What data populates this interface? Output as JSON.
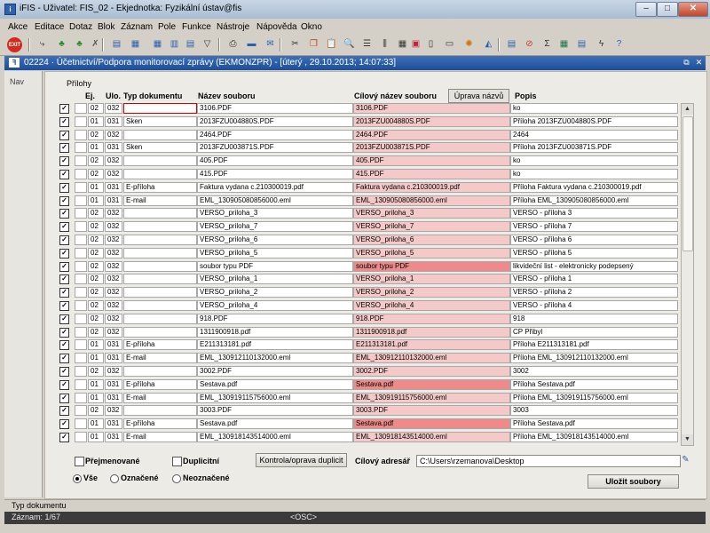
{
  "app": {
    "title": "iFIS - Uživatel: FIS_02 - Ekjednotka: Fyzikální ústav@fis"
  },
  "menu": [
    "Akce",
    "Editace",
    "Dotaz",
    "Blok",
    "Záznam",
    "Pole",
    "Funkce",
    "Nástroje",
    "Nápověda",
    "Okno"
  ],
  "document": {
    "title": "02224 · Účetnictví/Podpora monitorovací zprávy (EKMONZPR) - [úterý , 29.10.2013; 14:07:33]"
  },
  "nav": {
    "label": "Nav"
  },
  "group": {
    "title": "Přílohy"
  },
  "columns": {
    "ej": "Ej.",
    "ulo": "Ulo.",
    "typ": "Typ dokumentu",
    "nazev": "Název souboru",
    "cil": "Cílový název souboru",
    "uprava_btn": "Úprava názvů",
    "popis": "Popis"
  },
  "rows": [
    {
      "ej": "02",
      "ulo": "032",
      "typ": "",
      "nazev": "3106.PDF",
      "cil": "3106.PDF",
      "popis": "ko",
      "hl": 0
    },
    {
      "ej": "01",
      "ulo": "031",
      "typ": "Sken",
      "nazev": "2013FZU004880S.PDF",
      "cil": "2013FZU004880S.PDF",
      "popis": "Příloha 2013FZU004880S.PDF",
      "hl": 0
    },
    {
      "ej": "02",
      "ulo": "032",
      "typ": "",
      "nazev": "2464.PDF",
      "cil": "2464.PDF",
      "popis": "2464",
      "hl": 0
    },
    {
      "ej": "01",
      "ulo": "031",
      "typ": "Sken",
      "nazev": "2013FZU003871S.PDF",
      "cil": "2013FZU003871S.PDF",
      "popis": "Příloha 2013FZU003871S.PDF",
      "hl": 0
    },
    {
      "ej": "02",
      "ulo": "032",
      "typ": "",
      "nazev": "405.PDF",
      "cil": "405.PDF",
      "popis": "ko",
      "hl": 0
    },
    {
      "ej": "02",
      "ulo": "032",
      "typ": "",
      "nazev": "415.PDF",
      "cil": "415.PDF",
      "popis": "ko",
      "hl": 0
    },
    {
      "ej": "01",
      "ulo": "031",
      "typ": "E-příloha",
      "nazev": "Faktura vydana c.210300019.pdf",
      "cil": "Faktura vydana c.210300019.pdf",
      "popis": "Příloha Faktura vydana c.210300019.pdf",
      "hl": 0
    },
    {
      "ej": "01",
      "ulo": "031",
      "typ": "E-mail",
      "nazev": "EML_130905080856000.eml",
      "cil": "EML_130905080856000.eml",
      "popis": "Příloha EML_130905080856000.eml",
      "hl": 0
    },
    {
      "ej": "02",
      "ulo": "032",
      "typ": "",
      "nazev": "VERSO_priloha_3",
      "cil": "VERSO_priloha_3",
      "popis": "VERSO - příloha 3",
      "hl": 0
    },
    {
      "ej": "02",
      "ulo": "032",
      "typ": "",
      "nazev": "VERSO_priloha_7",
      "cil": "VERSO_priloha_7",
      "popis": "VERSO - příloha 7",
      "hl": 0
    },
    {
      "ej": "02",
      "ulo": "032",
      "typ": "",
      "nazev": "VERSO_priloha_6",
      "cil": "VERSO_priloha_6",
      "popis": "VERSO - příloha 6",
      "hl": 0
    },
    {
      "ej": "02",
      "ulo": "032",
      "typ": "",
      "nazev": "VERSO_priloha_5",
      "cil": "VERSO_priloha_5",
      "popis": "VERSO - příloha 5",
      "hl": 0
    },
    {
      "ej": "02",
      "ulo": "032",
      "typ": "",
      "nazev": "soubor typu PDF",
      "cil": "soubor typu PDF",
      "popis": "likvideční list - elektronicky podepsený",
      "hl": 1
    },
    {
      "ej": "02",
      "ulo": "032",
      "typ": "",
      "nazev": "VERSO_priloha_1",
      "cil": "VERSO_priloha_1",
      "popis": "VERSO - příloha 1",
      "hl": 0
    },
    {
      "ej": "02",
      "ulo": "032",
      "typ": "",
      "nazev": "VERSO_priloha_2",
      "cil": "VERSO_priloha_2",
      "popis": "VERSO - příloha 2",
      "hl": 0
    },
    {
      "ej": "02",
      "ulo": "032",
      "typ": "",
      "nazev": "VERSO_priloha_4",
      "cil": "VERSO_priloha_4",
      "popis": "VERSO - příloha 4",
      "hl": 0
    },
    {
      "ej": "02",
      "ulo": "032",
      "typ": "",
      "nazev": "918.PDF",
      "cil": "918.PDF",
      "popis": "918",
      "hl": 0
    },
    {
      "ej": "02",
      "ulo": "032",
      "typ": "",
      "nazev": "1311900918.pdf",
      "cil": "1311900918.pdf",
      "popis": "CP Přibyl",
      "hl": 0
    },
    {
      "ej": "01",
      "ulo": "031",
      "typ": "E-příloha",
      "nazev": "E211313181.pdf",
      "cil": "E211313181.pdf",
      "popis": "Příloha E211313181.pdf",
      "hl": 0
    },
    {
      "ej": "01",
      "ulo": "031",
      "typ": "E-mail",
      "nazev": "EML_130912110132000.eml",
      "cil": "EML_130912110132000.eml",
      "popis": "Příloha EML_130912110132000.eml",
      "hl": 0
    },
    {
      "ej": "02",
      "ulo": "032",
      "typ": "",
      "nazev": "3002.PDF",
      "cil": "3002.PDF",
      "popis": "3002",
      "hl": 0
    },
    {
      "ej": "01",
      "ulo": "031",
      "typ": "E-příloha",
      "nazev": "Sestava.pdf",
      "cil": "Sestava.pdf",
      "popis": "Příloha Sestava.pdf",
      "hl": 1
    },
    {
      "ej": "01",
      "ulo": "031",
      "typ": "E-mail",
      "nazev": "EML_130919115756000.eml",
      "cil": "EML_130919115756000.eml",
      "popis": "Příloha EML_130919115756000.eml",
      "hl": 0
    },
    {
      "ej": "02",
      "ulo": "032",
      "typ": "",
      "nazev": "3003.PDF",
      "cil": "3003.PDF",
      "popis": "3003",
      "hl": 0
    },
    {
      "ej": "01",
      "ulo": "031",
      "typ": "E-příloha",
      "nazev": "Sestava.pdf",
      "cil": "Sestava.pdf",
      "popis": "Příloha Sestava.pdf",
      "hl": 1
    },
    {
      "ej": "01",
      "ulo": "031",
      "typ": "E-mail",
      "nazev": "EML_130918143514000.eml",
      "cil": "EML_130918143514000.eml",
      "popis": "Příloha EML_130918143514000.eml",
      "hl": 0
    }
  ],
  "filters": {
    "prejmenovane": "Přejmenované",
    "duplicitni": "Duplicitní",
    "kontrola_btn": "Kontrola/oprava duplicit",
    "cilovy_label": "Cílový adresář",
    "cilovy_value": "C:\\Users\\rzemanova\\Desktop"
  },
  "radios": {
    "vse": "Vše",
    "oznacene": "Označené",
    "neoznacene": "Neoznačené"
  },
  "save_btn": "Uložit soubory",
  "status": {
    "field": "Typ dokumentu",
    "record": "Záznam: 1/67",
    "osc": "<OSC>"
  },
  "colors": {
    "cil_bg": "#f6c9c9",
    "cil_hl": "#ee8a8a",
    "title_blue": "#1b4f99"
  }
}
